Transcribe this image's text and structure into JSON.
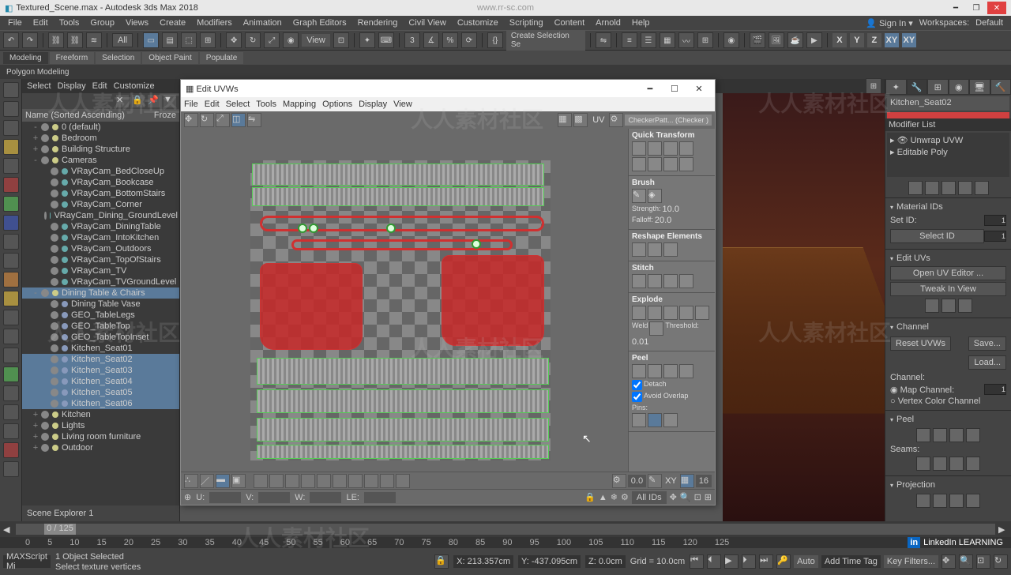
{
  "title": "Textured_Scene.max - Autodesk 3ds Max 2018",
  "watermark_url": "www.rr-sc.com",
  "signin": "Sign In",
  "workspace_label": "Workspaces:",
  "workspace_value": "Default",
  "menus": [
    "File",
    "Edit",
    "Tools",
    "Group",
    "Views",
    "Create",
    "Modifiers",
    "Animation",
    "Graph Editors",
    "Rendering",
    "Civil View",
    "Customize",
    "Scripting",
    "Content",
    "Arnold",
    "Help"
  ],
  "toolbar_dropdown": "All",
  "view_label": "View",
  "create_sel_label": "Create Selection Se",
  "ribbon_tabs": [
    "Modeling",
    "Freeform",
    "Selection",
    "Object Paint",
    "Populate"
  ],
  "ribbon_sub": "Polygon Modeling",
  "scene_hdr": [
    "Select",
    "Display",
    "Edit",
    "Customize"
  ],
  "tree_header": "Name (Sorted Ascending)",
  "tree_header_col": "Froze",
  "tree": [
    {
      "lvl": 1,
      "exp": "-",
      "type": "grp",
      "label": "0 (default)"
    },
    {
      "lvl": 1,
      "exp": "+",
      "type": "grp",
      "label": "Bedroom"
    },
    {
      "lvl": 1,
      "exp": "+",
      "type": "grp",
      "label": "Building Structure"
    },
    {
      "lvl": 1,
      "exp": "-",
      "type": "grp",
      "label": "Cameras"
    },
    {
      "lvl": 2,
      "type": "cam",
      "label": "VRayCam_BedCloseUp"
    },
    {
      "lvl": 2,
      "type": "cam",
      "label": "VRayCam_Bookcase"
    },
    {
      "lvl": 2,
      "type": "cam",
      "label": "VRayCam_BottomStairs"
    },
    {
      "lvl": 2,
      "type": "cam",
      "label": "VRayCam_Corner"
    },
    {
      "lvl": 2,
      "type": "cam",
      "label": "VRayCam_Dining_GroundLevel"
    },
    {
      "lvl": 2,
      "type": "cam",
      "label": "VRayCam_DiningTable"
    },
    {
      "lvl": 2,
      "type": "cam",
      "label": "VRayCam_IntoKitchen"
    },
    {
      "lvl": 2,
      "type": "cam",
      "label": "VRayCam_Outdoors"
    },
    {
      "lvl": 2,
      "type": "cam",
      "label": "VRayCam_TopOfStairs"
    },
    {
      "lvl": 2,
      "type": "cam",
      "label": "VRayCam_TV"
    },
    {
      "lvl": 2,
      "type": "cam",
      "label": "VRayCam_TVGroundLevel"
    },
    {
      "lvl": 1,
      "exp": "-",
      "type": "grp",
      "label": "Dining Table & Chairs",
      "sel": true
    },
    {
      "lvl": 2,
      "type": "geo",
      "label": "Dining Table Vase"
    },
    {
      "lvl": 2,
      "type": "geo",
      "label": "GEO_TableLegs"
    },
    {
      "lvl": 2,
      "type": "geo",
      "label": "GEO_TableTop"
    },
    {
      "lvl": 2,
      "type": "geo",
      "label": "GEO_TableTopInset"
    },
    {
      "lvl": 2,
      "type": "geo",
      "label": "Kitchen_Seat01"
    },
    {
      "lvl": 2,
      "type": "geo",
      "label": "Kitchen_Seat02",
      "sel": true
    },
    {
      "lvl": 2,
      "type": "geo",
      "label": "Kitchen_Seat03",
      "sel": true
    },
    {
      "lvl": 2,
      "type": "geo",
      "label": "Kitchen_Seat04",
      "sel": true
    },
    {
      "lvl": 2,
      "type": "geo",
      "label": "Kitchen_Seat05",
      "sel": true
    },
    {
      "lvl": 2,
      "type": "geo",
      "label": "Kitchen_Seat06",
      "sel": true
    },
    {
      "lvl": 1,
      "exp": "+",
      "type": "grp",
      "label": "Kitchen"
    },
    {
      "lvl": 1,
      "exp": "+",
      "type": "grp",
      "label": "Lights"
    },
    {
      "lvl": 1,
      "exp": "+",
      "type": "grp",
      "label": "Living room furniture"
    },
    {
      "lvl": 1,
      "exp": "+",
      "type": "grp",
      "label": "Outdoor"
    }
  ],
  "scene_footer": "Scene Explorer 1",
  "uv": {
    "title": "Edit UVWs",
    "menus": [
      "File",
      "Edit",
      "Select",
      "Tools",
      "Mapping",
      "Options",
      "Display",
      "View"
    ],
    "uv_label": "UV",
    "checker_label": "CheckerPatt... (Checker )",
    "side": {
      "qt": "Quick Transform",
      "brush": "Brush",
      "strength_lbl": "Strength:",
      "strength_val": "10.0",
      "falloff_lbl": "Falloff:",
      "falloff_val": "20.0",
      "reshape": "Reshape Elements",
      "stitch": "Stitch",
      "explode": "Explode",
      "weld_lbl": "Weld",
      "thresh_lbl": "Threshold:",
      "thresh_val": "0.01",
      "peel": "Peel",
      "detach": "Detach",
      "avoid": "Avoid Overlap",
      "pins": "Pins:"
    },
    "bot": {
      "u": "U:",
      "v": "V:",
      "w": "W:",
      "le": "LE:",
      "xy": "XY",
      "num": "16",
      "spin": "0.0",
      "allids": "All IDs"
    }
  },
  "right": {
    "obj_name": "Kitchen_Seat02",
    "modlist_lbl": "Modifier List",
    "mods": [
      "Unwrap UVW",
      "Editable Poly"
    ],
    "matids": "Material IDs",
    "setid": "Set ID:",
    "selectid": "Select ID",
    "id1": "1",
    "edituvs": "Edit UVs",
    "openuv": "Open UV Editor ...",
    "tweak": "Tweak In View",
    "channel": "Channel",
    "reset": "Reset UVWs",
    "save": "Save...",
    "load": "Load...",
    "chlbl": "Channel:",
    "mapch": "Map Channel:",
    "mapchval": "1",
    "vcc": "Vertex Color Channel",
    "peel": "Peel",
    "seams": "Seams:",
    "proj": "Projection"
  },
  "timeline": {
    "frame": "0 / 125"
  },
  "track_ticks": [
    "0",
    "5",
    "10",
    "15",
    "20",
    "25",
    "30",
    "35",
    "40",
    "45",
    "50",
    "55",
    "60",
    "65",
    "70",
    "75",
    "80",
    "85",
    "90",
    "95",
    "100",
    "105",
    "110",
    "115",
    "120",
    "125"
  ],
  "status": {
    "script": "MAXScript Mi",
    "sel": "1 Object Selected",
    "hint": "Select texture vertices",
    "x": "X: 213.357cm",
    "y": "Y: -437.095cm",
    "z": "Z: 0.0cm",
    "grid": "Grid = 10.0cm",
    "auto": "Auto",
    "addtag": "Add Time Tag",
    "keyf": "Key Filters..."
  },
  "linkedin": "LinkedIn LEARNING"
}
